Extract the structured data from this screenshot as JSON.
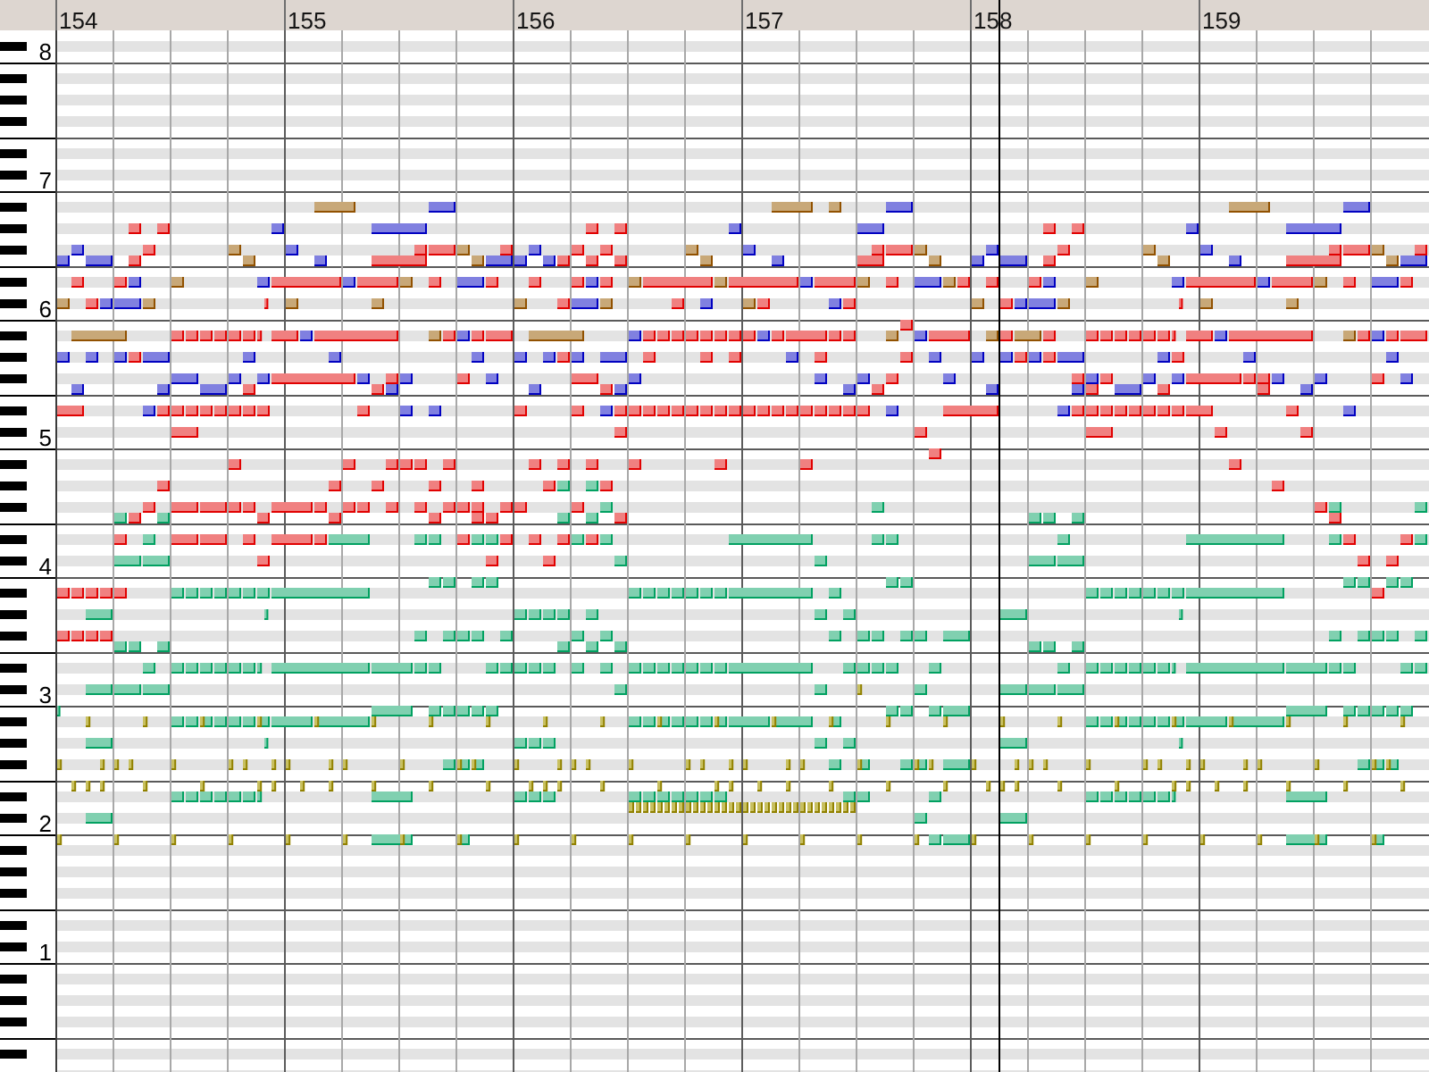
{
  "ruler": {
    "measures": [
      "154",
      "155",
      "156",
      "157",
      "158",
      "159"
    ]
  },
  "keyboard": {
    "octave_labels": [
      "8",
      "7",
      "6",
      "5",
      "4",
      "3",
      "2",
      "1"
    ]
  },
  "tracks": [
    {
      "color": "#f08080"
    },
    {
      "color": "#8080e0"
    },
    {
      "color": "#c8a878"
    },
    {
      "color": "#80d0b0"
    },
    {
      "color": "#c8c060"
    }
  ],
  "playhead": {
    "level": 0.686
  }
}
